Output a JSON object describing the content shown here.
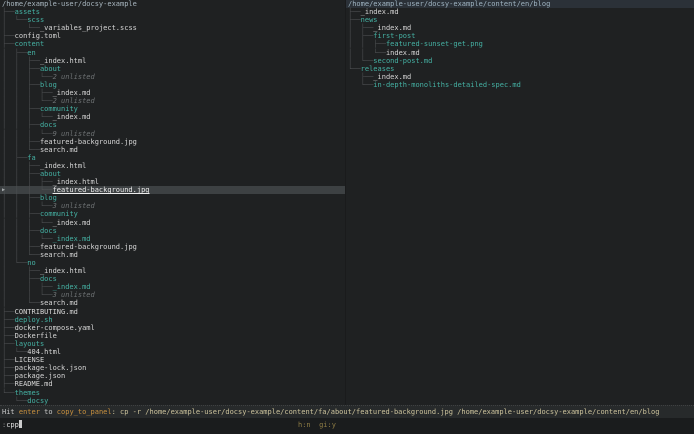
{
  "colors": {
    "background": "#1f2122",
    "directory_teal": "#45b2a4",
    "file_text": "#d6d6d6",
    "unlisted_gray": "#6e7274",
    "selected_row_bg": "#3d4143",
    "right_header_bg": "#2b3138",
    "status_highlight": "#c9913f",
    "flags_gold": "#8f7d45"
  },
  "left_panel": {
    "root": "/home/example-user/docsy-example",
    "rows": [
      {
        "prefix": "├──",
        "name": "assets",
        "type": "dir"
      },
      {
        "prefix": "│  └──",
        "name": "scss",
        "type": "dir"
      },
      {
        "prefix": "│     └──",
        "name": "_variables_project.scss",
        "type": "file"
      },
      {
        "prefix": "├──",
        "name": "config.toml",
        "type": "file"
      },
      {
        "prefix": "├──",
        "name": "content",
        "type": "dir"
      },
      {
        "prefix": "│  ├──",
        "name": "en",
        "type": "dir"
      },
      {
        "prefix": "│  │  ├──",
        "name": "_index.html",
        "type": "file"
      },
      {
        "prefix": "│  │  ├──",
        "name": "about",
        "type": "dir"
      },
      {
        "prefix": "│  │  │  └──",
        "name": "2 unlisted",
        "type": "unlisted"
      },
      {
        "prefix": "│  │  ├──",
        "name": "blog",
        "type": "dir"
      },
      {
        "prefix": "│  │  │  ├──",
        "name": "_index.md",
        "type": "file"
      },
      {
        "prefix": "│  │  │  └──",
        "name": "2 unlisted",
        "type": "unlisted"
      },
      {
        "prefix": "│  │  ├──",
        "name": "community",
        "type": "dir"
      },
      {
        "prefix": "│  │  │  └──",
        "name": "_index.md",
        "type": "file"
      },
      {
        "prefix": "│  │  ├──",
        "name": "docs",
        "type": "dir"
      },
      {
        "prefix": "│  │  │  └──",
        "name": "9 unlisted",
        "type": "unlisted"
      },
      {
        "prefix": "│  │  ├──",
        "name": "featured-background.jpg",
        "type": "file"
      },
      {
        "prefix": "│  │  └──",
        "name": "search.md",
        "type": "file"
      },
      {
        "prefix": "│  ├──",
        "name": "fa",
        "type": "dir"
      },
      {
        "prefix": "│  │  ├──",
        "name": "_index.html",
        "type": "file"
      },
      {
        "prefix": "│  │  ├──",
        "name": "about",
        "type": "dir"
      },
      {
        "prefix": "│  │  │  ├──",
        "name": "_index.html",
        "type": "file"
      },
      {
        "prefix": "│  │  │  └──",
        "name": "featured-background.jpg",
        "type": "file",
        "selected": true
      },
      {
        "prefix": "│  │  ├──",
        "name": "blog",
        "type": "dir"
      },
      {
        "prefix": "│  │  │  └──",
        "name": "3 unlisted",
        "type": "unlisted"
      },
      {
        "prefix": "│  │  ├──",
        "name": "community",
        "type": "dir"
      },
      {
        "prefix": "│  │  │  └──",
        "name": "_index.md",
        "type": "file"
      },
      {
        "prefix": "│  │  ├──",
        "name": "docs",
        "type": "dir"
      },
      {
        "prefix": "│  │  │  └──",
        "name": "_index.md",
        "type": "new"
      },
      {
        "prefix": "│  │  ├──",
        "name": "featured-background.jpg",
        "type": "file"
      },
      {
        "prefix": "│  │  └──",
        "name": "search.md",
        "type": "file"
      },
      {
        "prefix": "│  └──",
        "name": "no",
        "type": "dir"
      },
      {
        "prefix": "│     ├──",
        "name": "_index.html",
        "type": "file"
      },
      {
        "prefix": "│     ├──",
        "name": "docs",
        "type": "dir"
      },
      {
        "prefix": "│     │  ├──",
        "name": "_index.md",
        "type": "new"
      },
      {
        "prefix": "│     │  └──",
        "name": "3 unlisted",
        "type": "unlisted"
      },
      {
        "prefix": "│     └──",
        "name": "search.md",
        "type": "file"
      },
      {
        "prefix": "├──",
        "name": "CONTRIBUTING.md",
        "type": "file"
      },
      {
        "prefix": "├──",
        "name": "deploy.sh",
        "type": "new"
      },
      {
        "prefix": "├──",
        "name": "docker-compose.yaml",
        "type": "file"
      },
      {
        "prefix": "├──",
        "name": "Dockerfile",
        "type": "file"
      },
      {
        "prefix": "├──",
        "name": "layouts",
        "type": "dir"
      },
      {
        "prefix": "│  └──",
        "name": "404.html",
        "type": "file"
      },
      {
        "prefix": "├──",
        "name": "LICENSE",
        "type": "file"
      },
      {
        "prefix": "├──",
        "name": "package-lock.json",
        "type": "file"
      },
      {
        "prefix": "├──",
        "name": "package.json",
        "type": "file"
      },
      {
        "prefix": "├──",
        "name": "README.md",
        "type": "file"
      },
      {
        "prefix": "└──",
        "name": "themes",
        "type": "dir"
      },
      {
        "prefix": "   └──",
        "name": "docsy",
        "type": "dir"
      }
    ]
  },
  "right_panel": {
    "root": "/home/example-user/docsy-example/content/en/blog",
    "rows": [
      {
        "prefix": "├──",
        "name": "_index.md",
        "type": "file"
      },
      {
        "prefix": "├──",
        "name": "news",
        "type": "dir"
      },
      {
        "prefix": "│  ├──",
        "name": "_index.md",
        "type": "file"
      },
      {
        "prefix": "│  ├──",
        "name": "first-post",
        "type": "dir"
      },
      {
        "prefix": "│  │  ├──",
        "name": "featured-sunset-get.png",
        "type": "new"
      },
      {
        "prefix": "│  │  └──",
        "name": "index.md",
        "type": "file"
      },
      {
        "prefix": "│  └──",
        "name": "second-post.md",
        "type": "new"
      },
      {
        "prefix": "└──",
        "name": "releases",
        "type": "dir"
      },
      {
        "prefix": "   ├──",
        "name": "_index.md",
        "type": "file"
      },
      {
        "prefix": "   └──",
        "name": "in-depth-monoliths-detailed-spec.md",
        "type": "new"
      }
    ]
  },
  "status_bar": {
    "hit": "Hit ",
    "key": "enter",
    "to": " to ",
    "verb": "copy_to_panel",
    "command": ": cp -r /home/example-user/docsy-example/content/fa/about/featured-background.jpg /home/example-user/docsy-example/content/en/blog"
  },
  "input_line": {
    "prompt": ":",
    "value": "cpp",
    "flags": "h:n  gi:y"
  },
  "selection_marker": "▶"
}
